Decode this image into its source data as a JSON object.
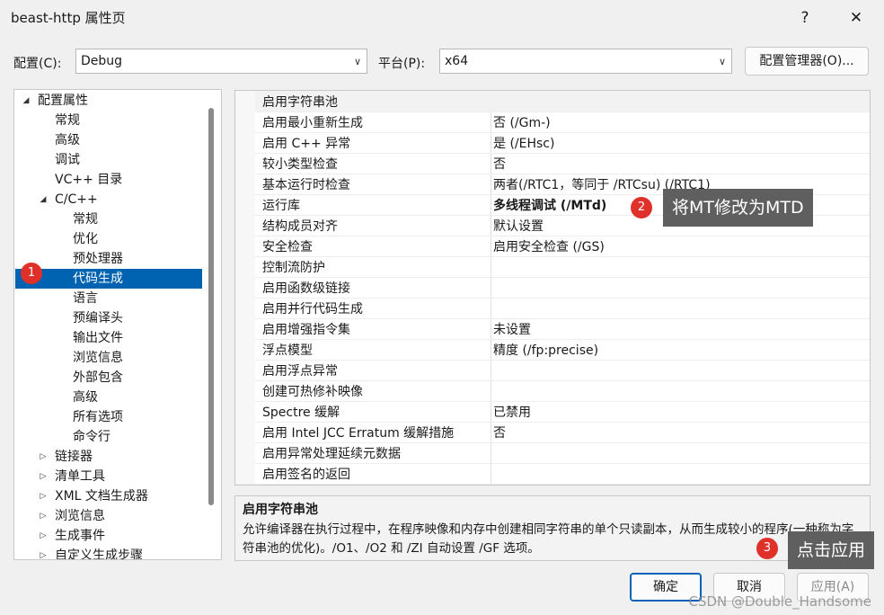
{
  "window": {
    "title": "beast-http 属性页",
    "help_btn": "?",
    "close_btn": "✕"
  },
  "toolbar": {
    "config_label": "配置(C):",
    "config_value": "Debug",
    "platform_label": "平台(P):",
    "platform_value": "x64",
    "config_manager_label": "配置管理器(O)..."
  },
  "tree": {
    "items": [
      {
        "label": "配置属性",
        "level": 0,
        "expander": "◢"
      },
      {
        "label": "常规",
        "level": 1
      },
      {
        "label": "高级",
        "level": 1
      },
      {
        "label": "调试",
        "level": 1
      },
      {
        "label": "VC++ 目录",
        "level": 1
      },
      {
        "label": "C/C++",
        "level": 1,
        "expander": "◢"
      },
      {
        "label": "常规",
        "level": 2
      },
      {
        "label": "优化",
        "level": 2
      },
      {
        "label": "预处理器",
        "level": 2
      },
      {
        "label": "代码生成",
        "level": 2,
        "selected": true
      },
      {
        "label": "语言",
        "level": 2
      },
      {
        "label": "预编译头",
        "level": 2
      },
      {
        "label": "输出文件",
        "level": 2
      },
      {
        "label": "浏览信息",
        "level": 2
      },
      {
        "label": "外部包含",
        "level": 2
      },
      {
        "label": "高级",
        "level": 2
      },
      {
        "label": "所有选项",
        "level": 2
      },
      {
        "label": "命令行",
        "level": 2
      },
      {
        "label": "链接器",
        "level": 1,
        "expander": "▷"
      },
      {
        "label": "清单工具",
        "level": 1,
        "expander": "▷"
      },
      {
        "label": "XML 文档生成器",
        "level": 1,
        "expander": "▷"
      },
      {
        "label": "浏览信息",
        "level": 1,
        "expander": "▷"
      },
      {
        "label": "生成事件",
        "level": 1,
        "expander": "▷"
      },
      {
        "label": "自定义生成步骤",
        "level": 1,
        "expander": "▷"
      }
    ]
  },
  "properties": [
    {
      "name": "启用字符串池",
      "value": ""
    },
    {
      "name": "启用最小重新生成",
      "value": "否 (/Gm-)"
    },
    {
      "name": "启用 C++ 异常",
      "value": "是 (/EHsc)"
    },
    {
      "name": "较小类型检查",
      "value": "否"
    },
    {
      "name": "基本运行时检查",
      "value": "两者(/RTC1，等同于 /RTCsu) (/RTC1)"
    },
    {
      "name": "运行库",
      "value": "多线程调试 (/MTd)",
      "bold": true
    },
    {
      "name": "结构成员对齐",
      "value": "默认设置"
    },
    {
      "name": "安全检查",
      "value": "启用安全检查 (/GS)"
    },
    {
      "name": "控制流防护",
      "value": ""
    },
    {
      "name": "启用函数级链接",
      "value": ""
    },
    {
      "name": "启用并行代码生成",
      "value": ""
    },
    {
      "name": "启用增强指令集",
      "value": "未设置"
    },
    {
      "name": "浮点模型",
      "value": "精度 (/fp:precise)"
    },
    {
      "name": "启用浮点异常",
      "value": ""
    },
    {
      "name": "创建可热修补映像",
      "value": ""
    },
    {
      "name": "Spectre 缓解",
      "value": "已禁用"
    },
    {
      "name": "启用 Intel JCC Erratum 缓解措施",
      "value": "否"
    },
    {
      "name": "启用异常处理延续元数据",
      "value": ""
    },
    {
      "name": "启用签名的返回",
      "value": ""
    }
  ],
  "description": {
    "title": "启用字符串池",
    "text": "允许编译器在执行过程中，在程序映像和内存中创建相同字符串的单个只读副本，从而生成较小的程序(一种称为字符串池的优化)。/O1、/O2 和 /ZI 自动设置 /GF 选项。"
  },
  "buttons": {
    "ok": "确定",
    "cancel": "取消",
    "apply": "应用(A)"
  },
  "annotations": {
    "marker1": "1",
    "marker2": "2",
    "marker3": "3",
    "callout2": "将MT修改为MTD",
    "callout3": "点击应用"
  },
  "watermark": "CSDN @Double_Handsome",
  "colors": {
    "selection": "#0063b1",
    "marker": "#e0302a",
    "callout_bg": "#5f5f5f"
  }
}
